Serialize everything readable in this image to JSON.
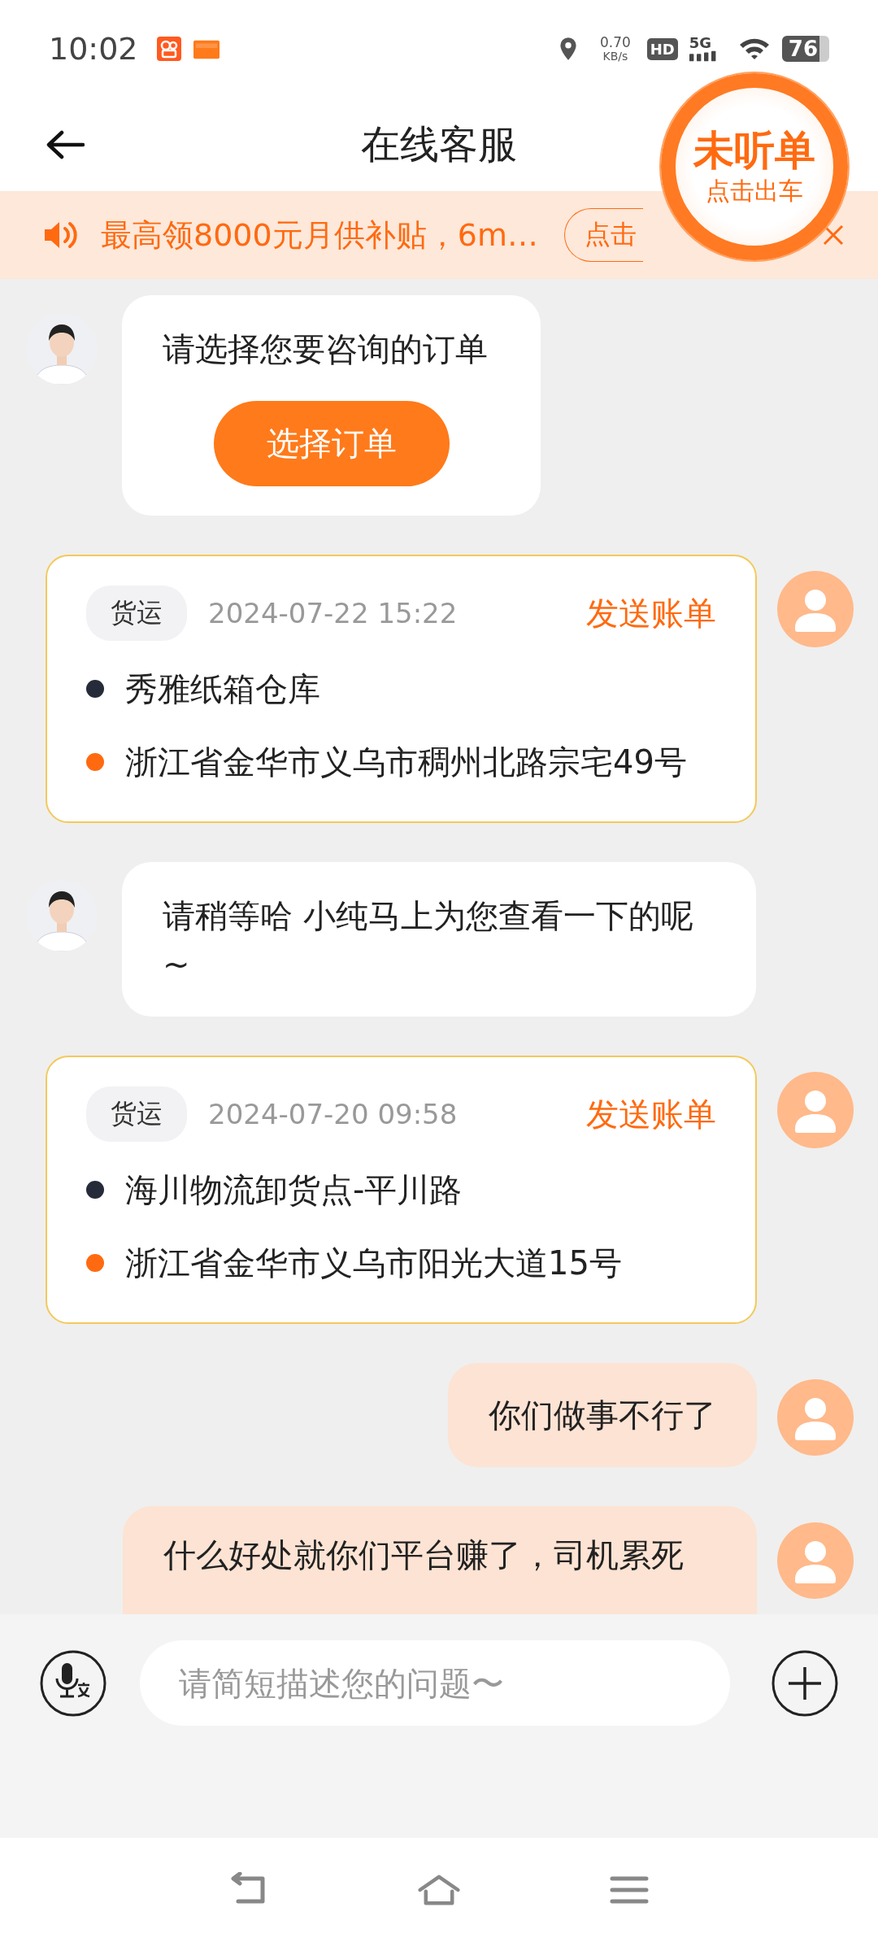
{
  "status_bar": {
    "time": "10:02",
    "net_speed": "0.70",
    "net_unit": "KB/s",
    "hd": "HD",
    "network": "5G",
    "battery": "76"
  },
  "header": {
    "title": "在线客服"
  },
  "floating_badge": {
    "title": "未听单",
    "subtitle": "点击出车"
  },
  "banner": {
    "text": "最高领8000元月供补贴，6m…",
    "button": "点击"
  },
  "messages": [
    {
      "kind": "agent_action",
      "text": "请选择您要咨询的订单",
      "button": "选择订单"
    },
    {
      "kind": "order",
      "tag": "货运",
      "time": "2024-07-22 15:22",
      "action": "发送账单",
      "stops": [
        {
          "name": "秀雅纸箱仓库",
          "color": "#262b3a"
        },
        {
          "name": "浙江省金华市义乌市稠州北路宗宅49号",
          "color": "#ff6a10"
        }
      ]
    },
    {
      "kind": "agent_text",
      "text": "请稍等哈 小纯马上为您查看一下的呢~"
    },
    {
      "kind": "order",
      "tag": "货运",
      "time": "2024-07-20 09:58",
      "action": "发送账单",
      "stops": [
        {
          "name": "海川物流卸货点-平川路",
          "color": "#262b3a"
        },
        {
          "name": "浙江省金华市义乌市阳光大道15号",
          "color": "#ff6a10"
        }
      ]
    },
    {
      "kind": "user_text",
      "text": "你们做事不行了"
    },
    {
      "kind": "user_text",
      "text": "什么好处就你们平台赚了，司机累死"
    }
  ],
  "input": {
    "placeholder": "请简短描述您的问题〜"
  }
}
